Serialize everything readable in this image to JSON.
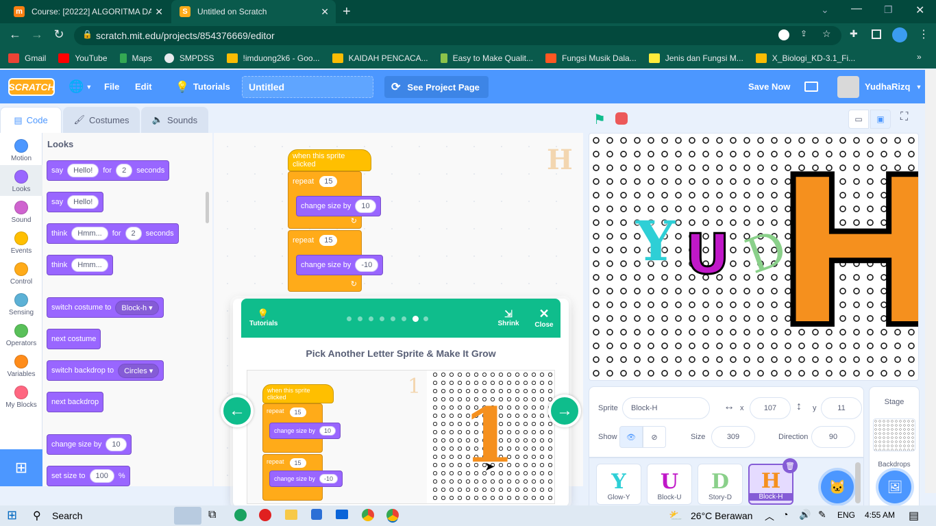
{
  "browser": {
    "tabs": [
      {
        "title": "Course: [20222] ALGORITMA DAI",
        "icon": "moodle-icon"
      },
      {
        "title": "Untitled on Scratch",
        "icon": "scratch-icon"
      }
    ],
    "url": "scratch.mit.edu/projects/854376669/editor",
    "bookmarks": [
      "Gmail",
      "YouTube",
      "Maps",
      "SMPDSS",
      "!imduong2k6 - Goo...",
      "KAIDAH PENCACA...",
      "Easy to Make Qualit...",
      "Fungsi Musik Dala...",
      "Jenis dan Fungsi M...",
      "X_Biologi_KD-3.1_Fi..."
    ]
  },
  "menubar": {
    "logo": "SCRATCH",
    "file": "File",
    "edit": "Edit",
    "tutorials": "Tutorials",
    "project_title": "Untitled",
    "see_project": "See Project Page",
    "save_now": "Save Now",
    "username": "YudhaRizq"
  },
  "editor_tabs": {
    "code": "Code",
    "costumes": "Costumes",
    "sounds": "Sounds"
  },
  "categories": [
    {
      "name": "Motion",
      "color": "#4c97ff"
    },
    {
      "name": "Looks",
      "color": "#9966ff"
    },
    {
      "name": "Sound",
      "color": "#cf63cf"
    },
    {
      "name": "Events",
      "color": "#ffbf00"
    },
    {
      "name": "Control",
      "color": "#ffab19"
    },
    {
      "name": "Sensing",
      "color": "#5cb1d6"
    },
    {
      "name": "Operators",
      "color": "#59c059"
    },
    {
      "name": "Variables",
      "color": "#ff8c1a"
    },
    {
      "name": "My Blocks",
      "color": "#ff6680"
    }
  ],
  "palette": {
    "heading": "Looks",
    "say_for": {
      "a": "say",
      "v1": "Hello!",
      "b": "for",
      "v2": "2",
      "c": "seconds"
    },
    "say": {
      "a": "say",
      "v1": "Hello!"
    },
    "think_for": {
      "a": "think",
      "v1": "Hmm...",
      "b": "for",
      "v2": "2",
      "c": "seconds"
    },
    "think": {
      "a": "think",
      "v1": "Hmm..."
    },
    "switch_costume": {
      "a": "switch costume to",
      "v1": "Block-h"
    },
    "next_costume": "next costume",
    "switch_backdrop": {
      "a": "switch backdrop to",
      "v1": "Circles"
    },
    "next_backdrop": "next backdrop",
    "change_size": {
      "a": "change size by",
      "v1": "10"
    },
    "set_size": {
      "a": "set size to",
      "v1": "100",
      "b": "%"
    }
  },
  "script": {
    "hat": "when this sprite clicked",
    "repeat1": {
      "label": "repeat",
      "times": "15"
    },
    "change1": {
      "label": "change size by",
      "value": "10"
    },
    "repeat2": {
      "label": "repeat",
      "times": "15"
    },
    "change2": {
      "label": "change size by",
      "value": "-10"
    },
    "sprite_thumb": "H"
  },
  "tutorial": {
    "label": "Tutorials",
    "shrink": "Shrink",
    "close": "Close",
    "title": "Pick Another Letter Sprite & Make It Grow",
    "steps_total": 8,
    "step_current": 7,
    "preview": {
      "hat": "when this sprite clicked",
      "repeat": "repeat",
      "times1": "15",
      "change": "change size by",
      "v1": "10",
      "times2": "15",
      "v2": "-10",
      "letter": "1"
    }
  },
  "stage": {
    "letters": [
      "Y",
      "U",
      "D",
      "H"
    ]
  },
  "sprite_info": {
    "sprite_label": "Sprite",
    "sprite_name": "Block-H",
    "x_label": "x",
    "x": "107",
    "y_label": "y",
    "y": "11",
    "show_label": "Show",
    "size_label": "Size",
    "size": "309",
    "direction_label": "Direction",
    "direction": "90"
  },
  "sprites": [
    {
      "name": "Glow-Y",
      "glyph": "Y",
      "color": "#2ecfd6"
    },
    {
      "name": "Block-U",
      "glyph": "U",
      "color": "#c018c8"
    },
    {
      "name": "Story-D",
      "glyph": "D",
      "color": "#8ad08a"
    },
    {
      "name": "Block-H",
      "glyph": "H",
      "color": "#f5901e",
      "selected": true
    }
  ],
  "stage_panel": {
    "title": "Stage",
    "backdrops": "Backdrops"
  },
  "taskbar": {
    "search": "Search",
    "weather": "26°C  Berawan",
    "lang": "ENG",
    "time": "4:55 AM"
  }
}
